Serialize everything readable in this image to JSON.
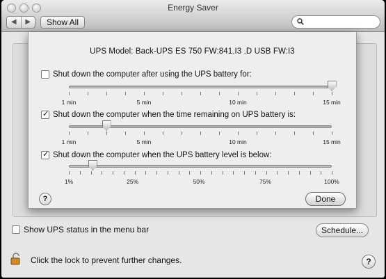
{
  "window": {
    "title": "Energy Saver"
  },
  "toolbar": {
    "back_glyph": "◀",
    "forward_glyph": "▶",
    "show_all_label": "Show All",
    "search_placeholder": "",
    "search_icon": "magnifier-icon"
  },
  "sheet": {
    "ups_model": "UPS Model:  Back-UPS ES 750 FW:841.I3 .D USB FW:I3",
    "options": [
      {
        "label": "Shut down the computer after using the UPS battery for:",
        "checked": false,
        "tick_labels": [
          "1 min",
          "5 min",
          "10 min",
          "15 min"
        ],
        "value": 15,
        "min": 1,
        "max": 15
      },
      {
        "label": "Shut down the computer when the time remaining on UPS battery is:",
        "checked": true,
        "tick_labels": [
          "1 min",
          "5 min",
          "10 min",
          "15 min"
        ],
        "value": 3,
        "min": 1,
        "max": 15
      },
      {
        "label": "Shut down the computer when the UPS battery level is below:",
        "checked": true,
        "tick_labels": [
          "1%",
          "25%",
          "50%",
          "75%",
          "100%"
        ],
        "value": 10,
        "min": 1,
        "max": 100
      }
    ],
    "done_label": "Done",
    "help_label": "?"
  },
  "bottom": {
    "show_ups_status_label": "Show UPS status in the menu bar",
    "schedule_label": "Schedule...",
    "lock_text": "Click the lock to prevent further changes.",
    "help_label": "?"
  }
}
